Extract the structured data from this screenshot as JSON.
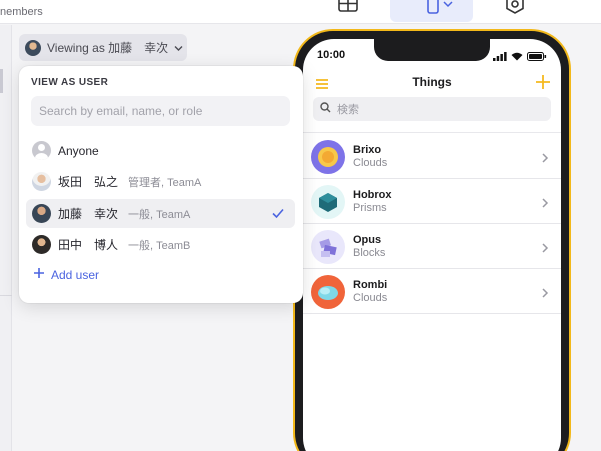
{
  "topbar": {
    "members_label": "nembers",
    "icons": [
      "table-icon",
      "mobile-device-icon",
      "chevron-down-icon",
      "settings-hexagon-icon"
    ]
  },
  "viewing_chip": {
    "label": "Viewing as 加藤　幸次",
    "icon": "chevron-down-icon"
  },
  "dropdown": {
    "heading": "VIEW AS USER",
    "search_placeholder": "Search by email, name, or role",
    "users": [
      {
        "name": "Anyone",
        "meta": "",
        "avatar": "anyone",
        "selected": false
      },
      {
        "name": "坂田　弘之",
        "meta": "管理者, TeamA",
        "avatar": "sakata",
        "selected": false
      },
      {
        "name": "加藤　幸次",
        "meta": "一般, TeamA",
        "avatar": "kato",
        "selected": true
      },
      {
        "name": "田中　博人",
        "meta": "一般, TeamB",
        "avatar": "tanaka",
        "selected": false
      }
    ],
    "add_user_label": "Add user"
  },
  "phone": {
    "status_time": "10:00",
    "title": "Things",
    "search_placeholder": "検索",
    "items": [
      {
        "title": "Brixo",
        "subtitle": "Clouds"
      },
      {
        "title": "Hobrox",
        "subtitle": "Prisms"
      },
      {
        "title": "Opus",
        "subtitle": "Blocks"
      },
      {
        "title": "Rombi",
        "subtitle": "Clouds"
      }
    ]
  },
  "colors": {
    "accent": "#4a63e0",
    "phone_frame": "#f2b81a",
    "phone_accent": "#f5b91f"
  }
}
